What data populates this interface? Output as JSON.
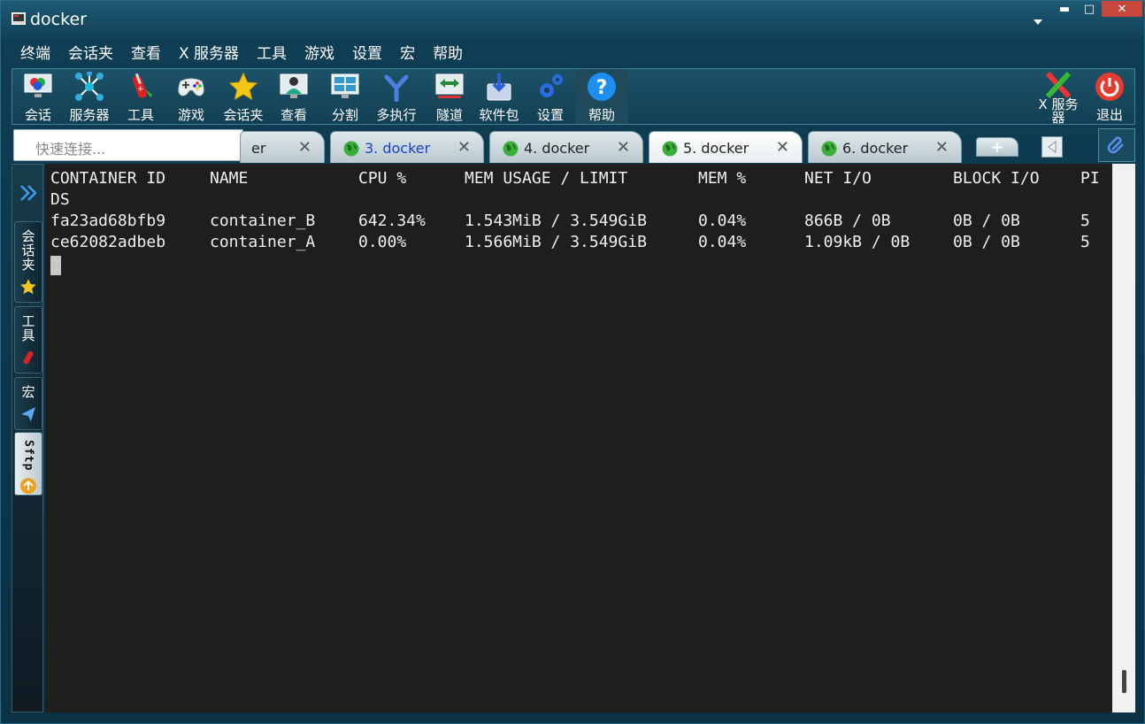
{
  "window": {
    "title": "docker",
    "controls": {
      "minimize": "▬",
      "maximize": "□",
      "close": "✕"
    }
  },
  "menu": [
    "终端",
    "会话夹",
    "查看",
    "X 服务器",
    "工具",
    "游戏",
    "设置",
    "宏",
    "帮助"
  ],
  "toolbar": {
    "session": "会话",
    "servers": "服务器",
    "tools": "工具",
    "games": "游戏",
    "sessions_folder": "会话夹",
    "view": "查看",
    "split": "分割",
    "multiexec": "多执行",
    "tunnel": "隧道",
    "packages": "软件包",
    "settings": "设置",
    "help": "帮助",
    "xserver_line1": "X 服务",
    "xserver_line2": "器",
    "exit": "退出"
  },
  "quick_connect": {
    "placeholder": "快速连接..."
  },
  "tabs": {
    "partial_label": "er",
    "items": [
      {
        "label": "3. docker",
        "state": "highlight"
      },
      {
        "label": "4. docker",
        "state": "normal"
      },
      {
        "label": "5. docker",
        "state": "active"
      },
      {
        "label": "6. docker",
        "state": "normal"
      }
    ],
    "close_glyph": "✕",
    "new_tab_glyph": "+"
  },
  "sidebar": {
    "sessions_folder": "会话夹",
    "tools": "工具",
    "macros": "宏",
    "sftp": "Sftp"
  },
  "terminal": {
    "header": [
      "CONTAINER ID",
      "NAME",
      "CPU %",
      "MEM USAGE / LIMIT",
      "MEM %",
      "NET I/O",
      "BLOCK I/O",
      "PI"
    ],
    "header_wrap": "DS",
    "rows": [
      [
        "fa23ad68bfb9",
        "container_B",
        "642.34%",
        "1.543MiB / 3.549GiB",
        "0.04%",
        "866B / 0B",
        "0B / 0B",
        "5"
      ],
      [
        "ce62082adbeb",
        "container_A",
        "0.00%",
        "1.566MiB / 3.549GiB",
        "0.04%",
        "1.09kB / 0B",
        "0B / 0B",
        "5"
      ]
    ]
  },
  "colors": {
    "accent_close": "#c9463d",
    "terminal_bg": "#1e1e1e",
    "tab_highlight_text": "#1a3fd6"
  }
}
